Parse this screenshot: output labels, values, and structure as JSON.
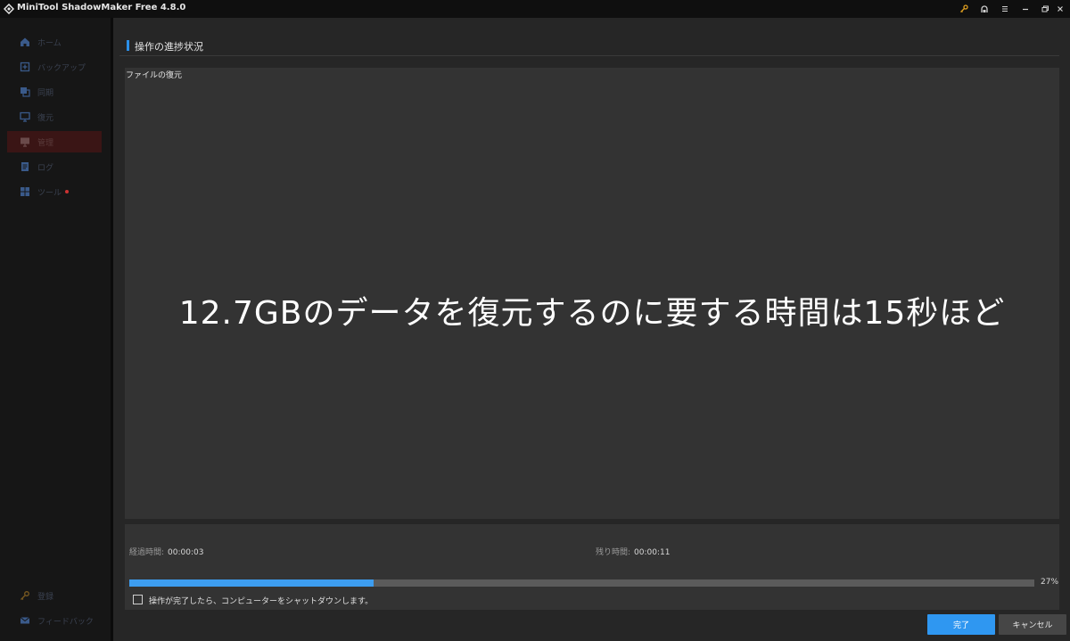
{
  "window": {
    "title": "MiniTool ShadowMaker Free 4.8.0",
    "controls": [
      "key-icon",
      "user-icon",
      "menu-icon",
      "minimize-icon",
      "restore-icon",
      "close-icon"
    ]
  },
  "sidebar": {
    "items": [
      {
        "label": "ホーム",
        "icon": "home-icon"
      },
      {
        "label": "バックアップ",
        "icon": "backup-icon"
      },
      {
        "label": "同期",
        "icon": "sync-icon"
      },
      {
        "label": "復元",
        "icon": "restore-monitor-icon"
      },
      {
        "label": "管理",
        "icon": "manage-icon"
      },
      {
        "label": "ログ",
        "icon": "log-icon"
      },
      {
        "label": "ツール",
        "icon": "tools-icon"
      }
    ],
    "active_index": 4,
    "bottom_items": [
      {
        "label": "登録",
        "icon": "key-icon"
      },
      {
        "label": "フィードバック",
        "icon": "mail-icon"
      }
    ]
  },
  "main": {
    "section_title": "操作の進捗状況",
    "log_title": "ファイルの復元",
    "caption": "12.7GBのデータを復元するのに要する時間は15秒ほど",
    "elapsed_label": "経過時間:",
    "elapsed_value": "00:00:03",
    "remaining_label": "残り時間:",
    "remaining_value": "00:00:11",
    "progress_percent": 27,
    "progress_text": "27%",
    "shutdown_label": "操作が完了したら、コンピューターをシャットダウンします。",
    "shutdown_checked": false
  },
  "buttons": {
    "finish": "完了",
    "cancel": "キャンセル"
  },
  "colors": {
    "accent": "#2f97f1",
    "progress_fill": "#3d9df0",
    "active_nav": "#3a1515",
    "key_icon": "#e0a020"
  }
}
